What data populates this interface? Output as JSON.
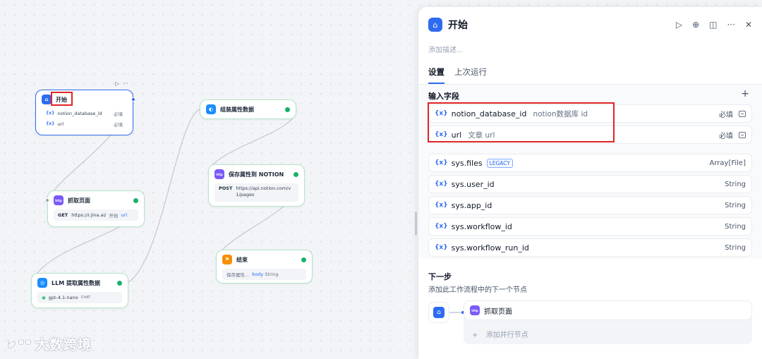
{
  "canvas": {
    "nodes": {
      "start": {
        "title": "开始",
        "fields": [
          {
            "icon": "{x}",
            "name": "notion_database_id",
            "required": "必填"
          },
          {
            "icon": "{x}",
            "name": "url",
            "required": "必填"
          }
        ]
      },
      "fetch": {
        "title": "抓取页面",
        "method": "GET",
        "url": "https://r.jina.ai/",
        "var_src": "开始",
        "var_name": "url",
        "icon_text": "http"
      },
      "llm": {
        "title": "LLM 提取属性数据",
        "model": "gpt-4.1-nano",
        "model_tag": "CHAT"
      },
      "assemble": {
        "title": "组装属性数据"
      },
      "save": {
        "title": "保存属性到 NOTION",
        "method": "POST",
        "url": "https://api.notion.com/v1/pages",
        "icon_text": "http"
      },
      "end": {
        "title": "结束",
        "var_src": "保存属性...",
        "var_name": "body",
        "var_type": "String"
      }
    }
  },
  "panel": {
    "title": "开始",
    "description_placeholder": "添加描述...",
    "tabs": [
      {
        "label": "设置",
        "active": true
      },
      {
        "label": "上次运行",
        "active": false
      }
    ],
    "input_fields_title": "输入字段",
    "input_fields": [
      {
        "name": "notion_database_id",
        "label": "notion数据库 id",
        "required": "必填"
      },
      {
        "name": "url",
        "label": "文章 url",
        "required": "必填"
      }
    ],
    "system_vars": [
      {
        "name": "sys.files",
        "badge": "LEGACY",
        "type": "Array[File]"
      },
      {
        "name": "sys.user_id",
        "type": "String"
      },
      {
        "name": "sys.app_id",
        "type": "String"
      },
      {
        "name": "sys.workflow_id",
        "type": "String"
      },
      {
        "name": "sys.workflow_run_id",
        "type": "String"
      }
    ],
    "next_step": {
      "title": "下一步",
      "subtitle": "添加此工作流程中的下一个节点",
      "node_label": "抓取页面",
      "add_parallel": "添加并行节点"
    }
  },
  "watermark": "大数跨境",
  "colors": {
    "accent": "#2e6bf0",
    "success": "#17b26a",
    "highlight": "#e02424"
  }
}
